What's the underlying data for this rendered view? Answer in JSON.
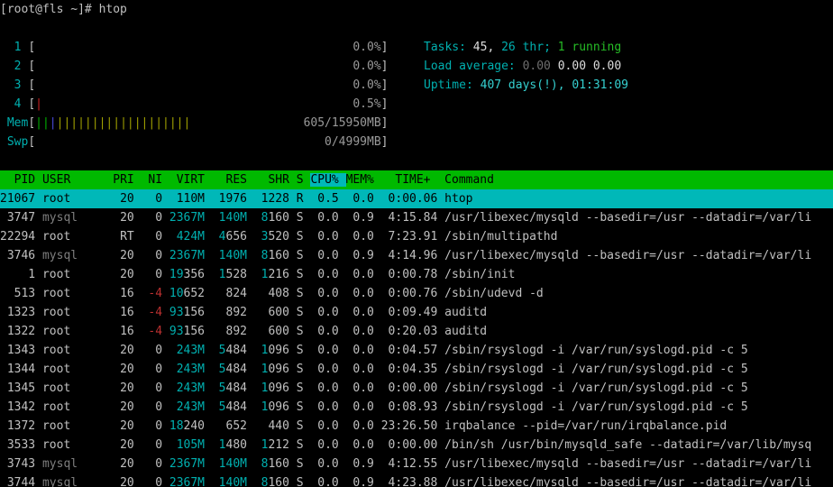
{
  "prompt": {
    "text": "[root@fls ~]# htop"
  },
  "palette": {
    "background": "#000000",
    "foreground": "#c0c0c0",
    "cyan": "#00b0b0",
    "bright_cyan": "#35d0d0",
    "green": "#26bd26",
    "red": "#bb3030",
    "header_bg": "#00b900",
    "selected_bg": "#00b8b8",
    "mem_used_tick": "#00b000",
    "mem_buffers_tick": "#4848d8",
    "mem_cache_tick": "#a0a000",
    "cpu_kernel_tick": "#cc2020"
  },
  "meters": [
    {
      "id": "cpu1",
      "label": "1",
      "kind": "cpu",
      "ticks": [],
      "value": "0.0%"
    },
    {
      "id": "cpu2",
      "label": "2",
      "kind": "cpu",
      "ticks": [],
      "value": "0.0%"
    },
    {
      "id": "cpu3",
      "label": "3",
      "kind": "cpu",
      "ticks": [],
      "value": "0.0%"
    },
    {
      "id": "cpu4",
      "label": "4",
      "kind": "cpu",
      "ticks": [
        {
          "color": "red",
          "count": 1
        }
      ],
      "value": "0.5%"
    },
    {
      "id": "mem",
      "label": "Mem",
      "kind": "named",
      "ticks": [
        {
          "color": "green",
          "count": 2
        },
        {
          "color": "blue",
          "count": 1
        },
        {
          "color": "yellow",
          "count": 19
        }
      ],
      "value": "605/15950MB"
    },
    {
      "id": "swp",
      "label": "Swp",
      "kind": "named",
      "ticks": [],
      "value": "0/4999MB"
    }
  ],
  "summary": {
    "tasks": {
      "label": "Tasks: ",
      "count": "45, ",
      "threads": "26 thr; ",
      "running": "1 running"
    },
    "load": {
      "label": "Load average: ",
      "one": "0.00 ",
      "five": "0.00 ",
      "fifteen": "0.00"
    },
    "uptime": {
      "label": "Uptime: ",
      "value": "407 days(!), 01:31:09"
    }
  },
  "table": {
    "sort_key": "cpu",
    "headers": [
      {
        "key": "pid",
        "text": "  PID"
      },
      {
        "key": "user",
        "text": "USER     "
      },
      {
        "key": "pri",
        "text": "PRI"
      },
      {
        "key": "ni",
        "text": " NI"
      },
      {
        "key": "virt",
        "text": " VIRT"
      },
      {
        "key": "res",
        "text": "  RES"
      },
      {
        "key": "shr",
        "text": "  SHR"
      },
      {
        "key": "s",
        "text": "S"
      },
      {
        "key": "cpu",
        "text": "CPU%"
      },
      {
        "key": "mem",
        "text": "MEM%"
      },
      {
        "key": "time",
        "text": "  TIME+ "
      },
      {
        "key": "command",
        "text": "Command"
      }
    ],
    "rows": [
      {
        "pid": "21067",
        "user": "root",
        "pri": "20",
        "ni": "0",
        "virt": "110M",
        "res": "1976",
        "shr": "1228",
        "s": "R",
        "cpu": "0.5",
        "mem": "0.0",
        "time": "0:00.06",
        "command": "htop",
        "selected": true
      },
      {
        "pid": "3747",
        "user": "mysql",
        "pri": "20",
        "ni": "0",
        "virt": "2367M",
        "res": "140M",
        "shr": "8160",
        "s": "S",
        "cpu": "0.0",
        "mem": "0.9",
        "time": "4:15.84",
        "command": "/usr/libexec/mysqld --basedir=/usr --datadir=/var/li",
        "selected": false
      },
      {
        "pid": "22294",
        "user": "root",
        "pri": "RT",
        "ni": "0",
        "virt": "424M",
        "res": "4656",
        "shr": "3520",
        "s": "S",
        "cpu": "0.0",
        "mem": "0.0",
        "time": "7:23.91",
        "command": "/sbin/multipathd",
        "selected": false
      },
      {
        "pid": "3746",
        "user": "mysql",
        "pri": "20",
        "ni": "0",
        "virt": "2367M",
        "res": "140M",
        "shr": "8160",
        "s": "S",
        "cpu": "0.0",
        "mem": "0.9",
        "time": "4:14.96",
        "command": "/usr/libexec/mysqld --basedir=/usr --datadir=/var/li",
        "selected": false
      },
      {
        "pid": "1",
        "user": "root",
        "pri": "20",
        "ni": "0",
        "virt": "19356",
        "res": "1528",
        "shr": "1216",
        "s": "S",
        "cpu": "0.0",
        "mem": "0.0",
        "time": "0:00.78",
        "command": "/sbin/init",
        "selected": false
      },
      {
        "pid": "513",
        "user": "root",
        "pri": "16",
        "ni": "-4",
        "virt": "10652",
        "res": "824",
        "shr": "408",
        "s": "S",
        "cpu": "0.0",
        "mem": "0.0",
        "time": "0:00.76",
        "command": "/sbin/udevd -d",
        "selected": false
      },
      {
        "pid": "1323",
        "user": "root",
        "pri": "16",
        "ni": "-4",
        "virt": "93156",
        "res": "892",
        "shr": "600",
        "s": "S",
        "cpu": "0.0",
        "mem": "0.0",
        "time": "0:09.49",
        "command": "auditd",
        "selected": false
      },
      {
        "pid": "1322",
        "user": "root",
        "pri": "16",
        "ni": "-4",
        "virt": "93156",
        "res": "892",
        "shr": "600",
        "s": "S",
        "cpu": "0.0",
        "mem": "0.0",
        "time": "0:20.03",
        "command": "auditd",
        "selected": false
      },
      {
        "pid": "1343",
        "user": "root",
        "pri": "20",
        "ni": "0",
        "virt": "243M",
        "res": "5484",
        "shr": "1096",
        "s": "S",
        "cpu": "0.0",
        "mem": "0.0",
        "time": "0:04.57",
        "command": "/sbin/rsyslogd -i /var/run/syslogd.pid -c 5",
        "selected": false
      },
      {
        "pid": "1344",
        "user": "root",
        "pri": "20",
        "ni": "0",
        "virt": "243M",
        "res": "5484",
        "shr": "1096",
        "s": "S",
        "cpu": "0.0",
        "mem": "0.0",
        "time": "0:04.35",
        "command": "/sbin/rsyslogd -i /var/run/syslogd.pid -c 5",
        "selected": false
      },
      {
        "pid": "1345",
        "user": "root",
        "pri": "20",
        "ni": "0",
        "virt": "243M",
        "res": "5484",
        "shr": "1096",
        "s": "S",
        "cpu": "0.0",
        "mem": "0.0",
        "time": "0:00.00",
        "command": "/sbin/rsyslogd -i /var/run/syslogd.pid -c 5",
        "selected": false
      },
      {
        "pid": "1342",
        "user": "root",
        "pri": "20",
        "ni": "0",
        "virt": "243M",
        "res": "5484",
        "shr": "1096",
        "s": "S",
        "cpu": "0.0",
        "mem": "0.0",
        "time": "0:08.93",
        "command": "/sbin/rsyslogd -i /var/run/syslogd.pid -c 5",
        "selected": false
      },
      {
        "pid": "1372",
        "user": "root",
        "pri": "20",
        "ni": "0",
        "virt": "18240",
        "res": "652",
        "shr": "440",
        "s": "S",
        "cpu": "0.0",
        "mem": "0.0",
        "time": "23:26.50",
        "command": "irqbalance --pid=/var/run/irqbalance.pid",
        "selected": false
      },
      {
        "pid": "3533",
        "user": "root",
        "pri": "20",
        "ni": "0",
        "virt": "105M",
        "res": "1480",
        "shr": "1212",
        "s": "S",
        "cpu": "0.0",
        "mem": "0.0",
        "time": "0:00.00",
        "command": "/bin/sh /usr/bin/mysqld_safe --datadir=/var/lib/mysq",
        "selected": false
      },
      {
        "pid": "3743",
        "user": "mysql",
        "pri": "20",
        "ni": "0",
        "virt": "2367M",
        "res": "140M",
        "shr": "8160",
        "s": "S",
        "cpu": "0.0",
        "mem": "0.9",
        "time": "4:12.55",
        "command": "/usr/libexec/mysqld --basedir=/usr --datadir=/var/li",
        "selected": false
      },
      {
        "pid": "3744",
        "user": "mysql",
        "pri": "20",
        "ni": "0",
        "virt": "2367M",
        "res": "140M",
        "shr": "8160",
        "s": "S",
        "cpu": "0.0",
        "mem": "0.9",
        "time": "4:23.88",
        "command": "/usr/libexec/mysqld --basedir=/usr --datadir=/var/li",
        "selected": false
      }
    ]
  }
}
